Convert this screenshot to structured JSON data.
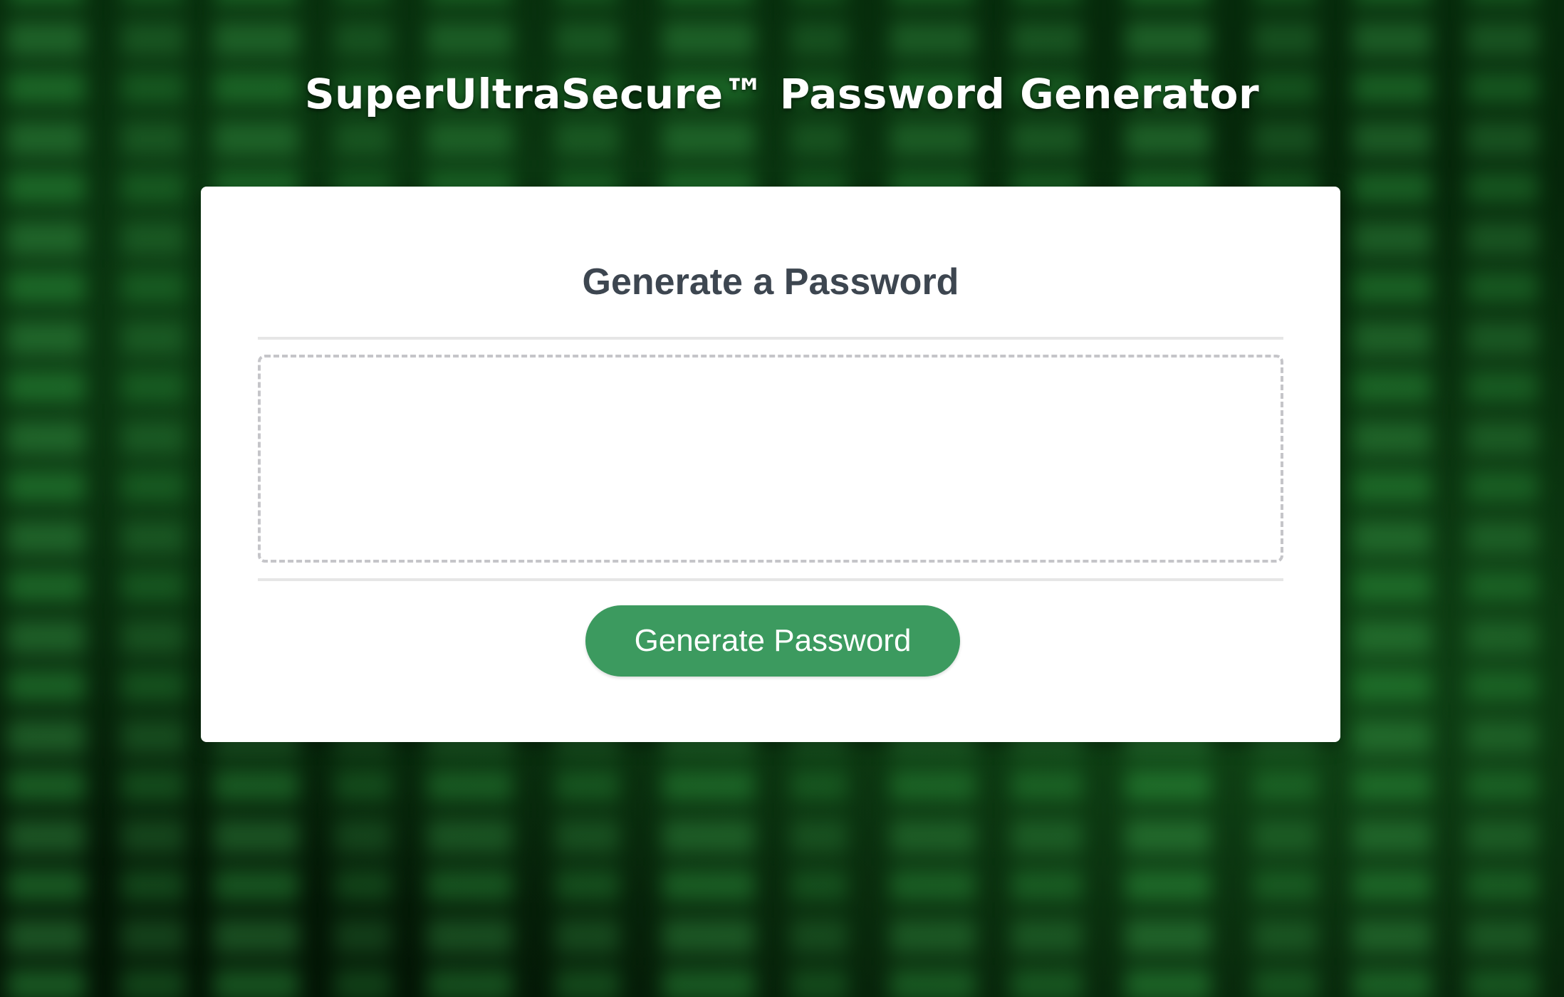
{
  "header": {
    "title": "SuperUltraSecure™ Password Generator"
  },
  "card": {
    "title": "Generate a Password",
    "password_field": {
      "value": "",
      "placeholder": ""
    },
    "generate_button_label": "Generate Password"
  },
  "colors": {
    "button": "#3c9a5f",
    "card_title": "#3d4650",
    "background": "#031a06"
  }
}
